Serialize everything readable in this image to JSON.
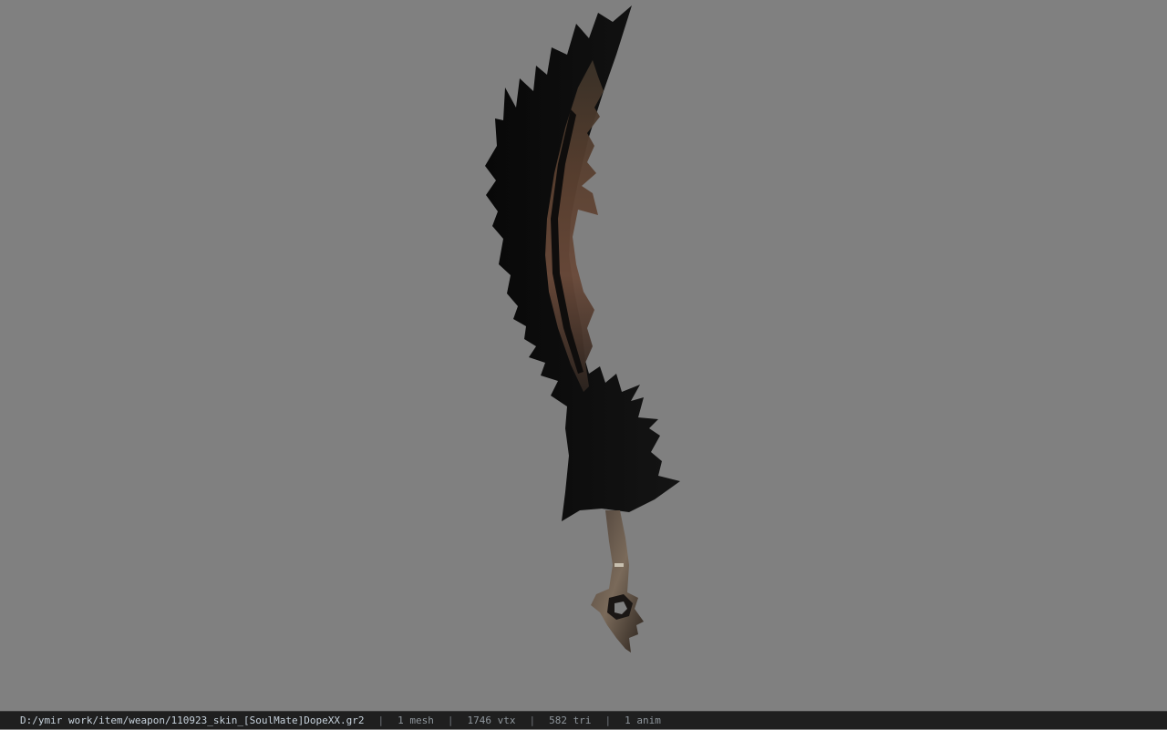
{
  "viewer": {
    "background_color": "#808080",
    "model_label": "sword-model",
    "status": {
      "file_path": "D:/ymir work/item/weapon/110923_skin_[SoulMate]DopeXX.gr2",
      "mesh_count": "1 mesh",
      "vertex_count": "1746 vtx",
      "triangle_count": "582 tri",
      "anim_count": "1 anim",
      "separator": "|"
    }
  }
}
